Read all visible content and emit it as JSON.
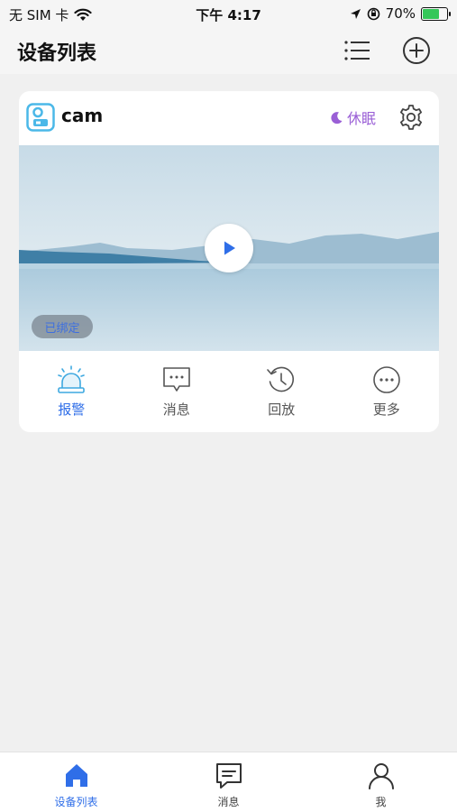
{
  "status_bar": {
    "carrier": "无 SIM 卡",
    "time": "下午 4:17",
    "battery_percent": "70%",
    "battery_level": 0.7
  },
  "nav": {
    "title": "设备列表"
  },
  "device": {
    "name": "cam",
    "sleep_label": "休眠",
    "bound_badge": "已绑定"
  },
  "actions": [
    {
      "label": "报警",
      "icon": "alarm-icon",
      "active": true
    },
    {
      "label": "消息",
      "icon": "message-icon",
      "active": false
    },
    {
      "label": "回放",
      "icon": "playback-icon",
      "active": false
    },
    {
      "label": "更多",
      "icon": "more-icon",
      "active": false
    }
  ],
  "tabbar": [
    {
      "label": "设备列表",
      "icon": "home-icon",
      "active": true
    },
    {
      "label": "消息",
      "icon": "message-icon",
      "active": false
    },
    {
      "label": "我",
      "icon": "user-icon",
      "active": false
    }
  ],
  "colors": {
    "accent": "#2f6ee8",
    "sleep": "#9a5fd6",
    "page_bg": "#f0f0f0"
  }
}
